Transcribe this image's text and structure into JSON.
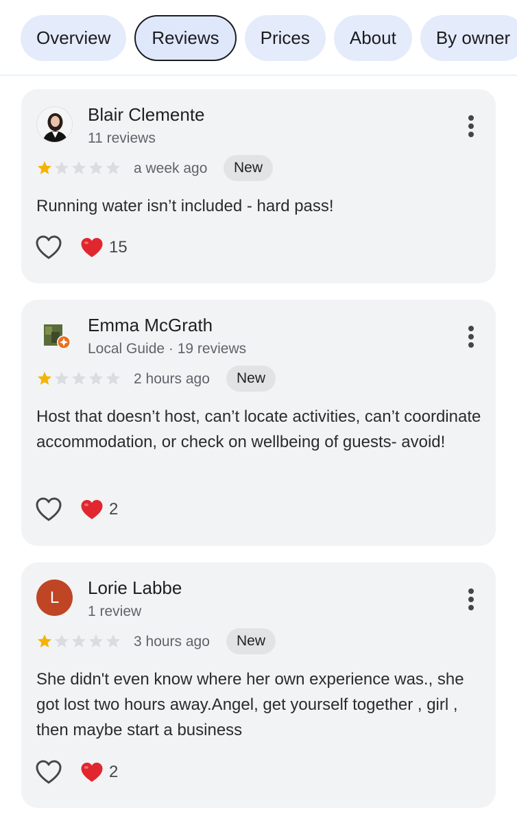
{
  "tabs": [
    {
      "label": "Overview",
      "active": false
    },
    {
      "label": "Reviews",
      "active": true
    },
    {
      "label": "Prices",
      "active": false
    },
    {
      "label": "About",
      "active": false
    },
    {
      "label": "By owner",
      "active": false
    }
  ],
  "reviews": [
    {
      "name": "Blair Clemente",
      "meta": "11 reviews",
      "rating": 1,
      "max_rating": 5,
      "time": "a week ago",
      "badge": "New",
      "text": "Running water isn’t included - hard pass!",
      "reaction_count": "15",
      "avatar": {
        "type": "photo"
      }
    },
    {
      "name": "Emma McGrath",
      "meta": "Local Guide · 19 reviews",
      "rating": 1,
      "max_rating": 5,
      "time": "2 hours ago",
      "badge": "New",
      "text": "Host that doesn’t host, can’t locate activities, can’t coordinate accommodation, or check on wellbeing of guests- avoid!",
      "reaction_count": "2",
      "avatar": {
        "type": "photo"
      }
    },
    {
      "name": "Lorie Labbe",
      "meta": "1 review",
      "rating": 1,
      "max_rating": 5,
      "time": "3 hours ago",
      "badge": "New",
      "text": "She didn't even know where her own experience was., she got lost two hours away.Angel, get yourself together , girl , then maybe start a business",
      "reaction_count": "2",
      "avatar": {
        "type": "letter",
        "letter": "L"
      }
    }
  ],
  "colors": {
    "tab_bg": "#e4ebfb",
    "card_bg": "#f2f3f5",
    "star_filled": "#f5b400",
    "star_empty": "#dadce0",
    "heart_red": "#e0272f",
    "avatar_letter_bg": "#bf4524"
  },
  "icons": {
    "more": "more-vert-icon",
    "like": "heart-outline-icon",
    "reaction": "red-heart-icon",
    "star": "star-icon",
    "local_guide": "local-guide-badge-icon"
  }
}
